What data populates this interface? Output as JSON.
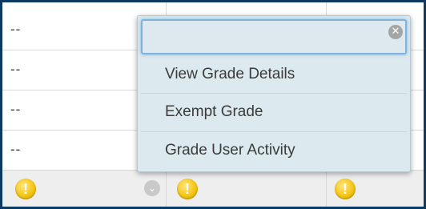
{
  "grid": {
    "rows": [
      {
        "cell1": "--"
      },
      {
        "cell1": "--"
      },
      {
        "cell1": "--"
      },
      {
        "cell1": "--"
      }
    ],
    "footer": {
      "warning_glyph": "!",
      "icons": [
        "warning-icon",
        "chevron-down-icon",
        "warning-icon",
        "warning-icon"
      ]
    }
  },
  "popup": {
    "search": {
      "value": "",
      "clear_glyph": "✕"
    },
    "menu": [
      {
        "label": "View Grade Details"
      },
      {
        "label": "Exempt Grade"
      },
      {
        "label": "Grade User Activity"
      }
    ]
  },
  "colors": {
    "frame_border": "#0c3a63",
    "popup_bg": "#dce9ee",
    "focus_ring": "#7fb3dc",
    "warning": "#f4c514"
  }
}
